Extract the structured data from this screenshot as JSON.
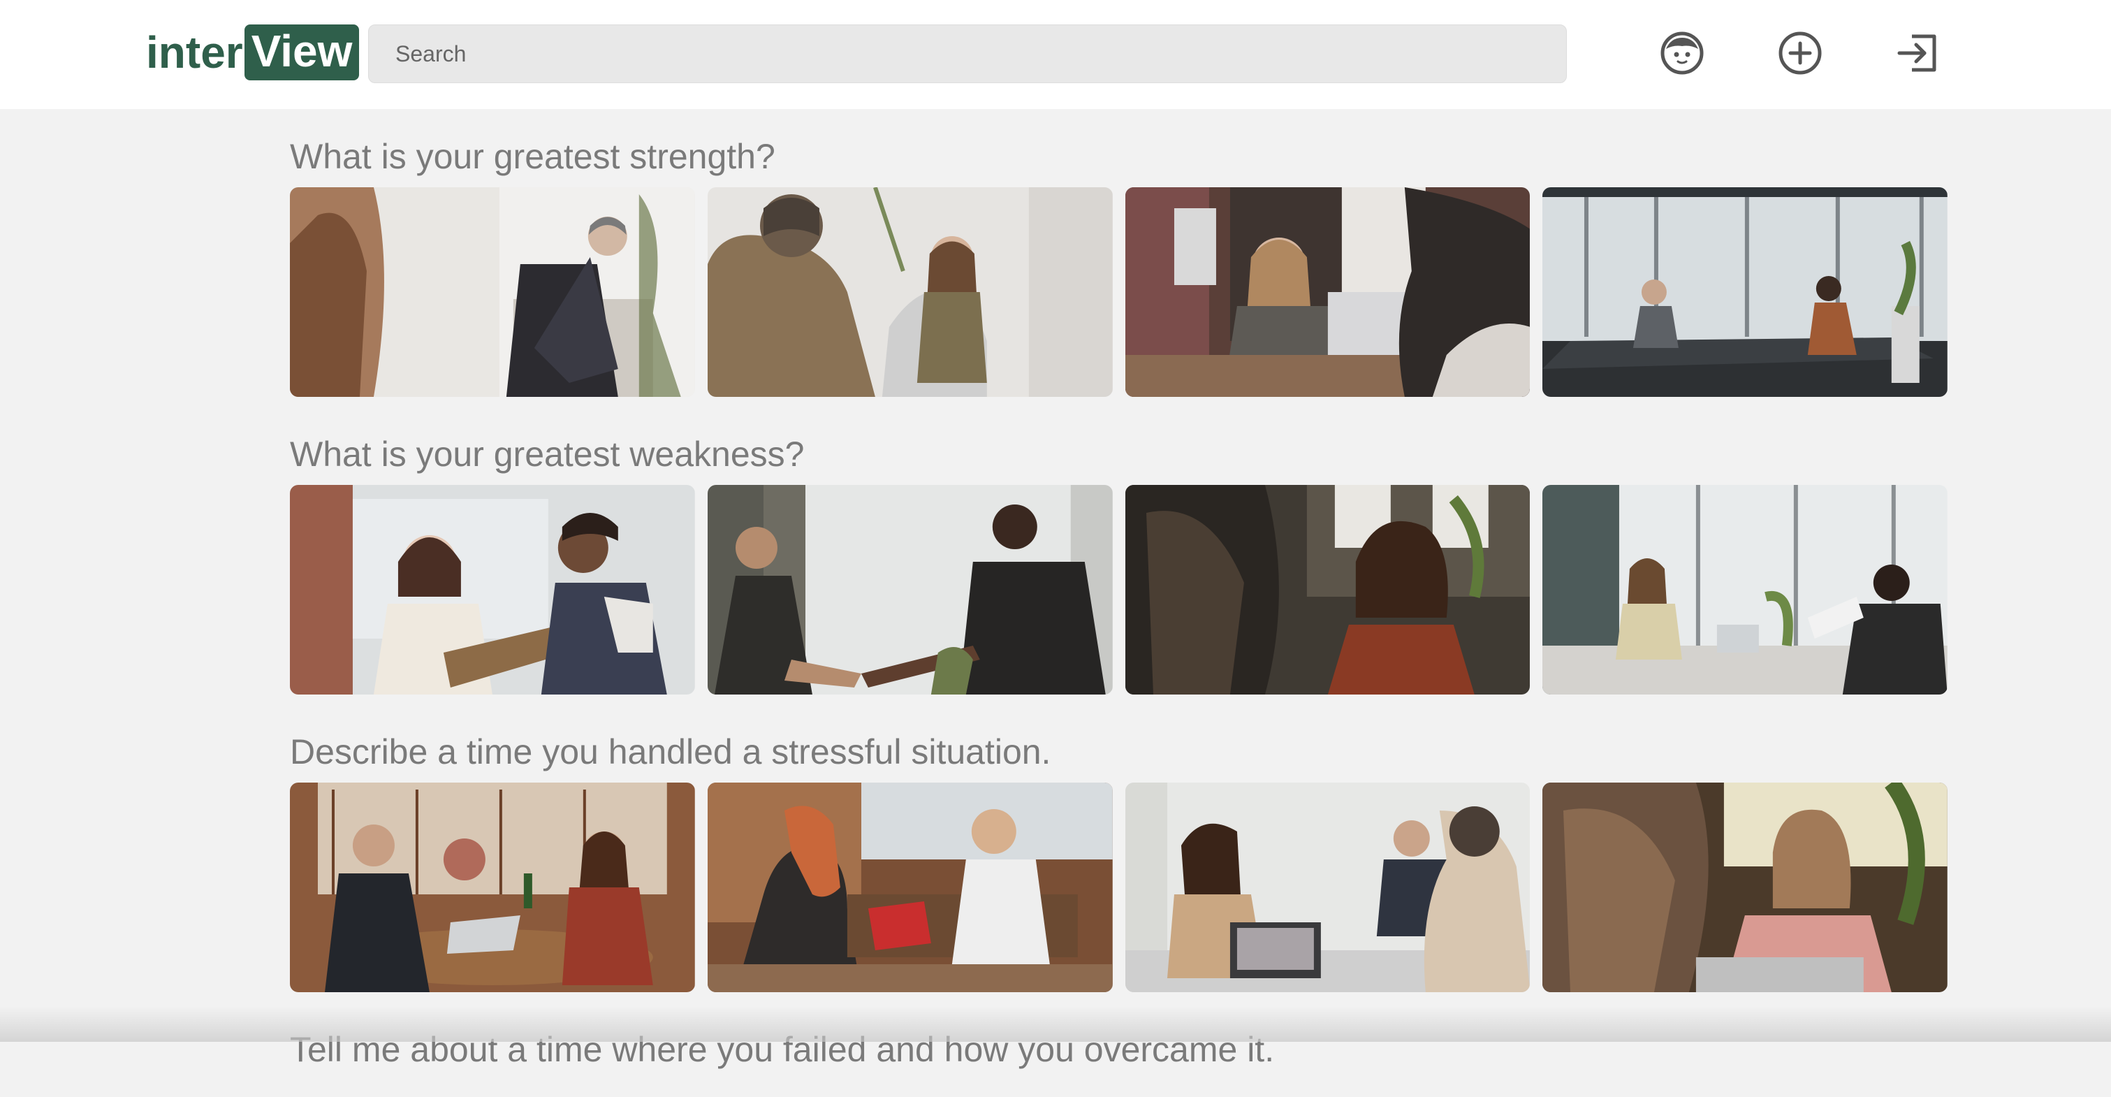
{
  "logo": {
    "part1": "inter",
    "part2": "View"
  },
  "search": {
    "placeholder": "Search"
  },
  "nav": [
    {
      "name": "profile-face-icon",
      "label": "Profile"
    },
    {
      "name": "add-circle-icon",
      "label": "Add"
    },
    {
      "name": "sign-out-icon",
      "label": "Sign out"
    }
  ],
  "sections": [
    {
      "title": "What is your greatest strength?"
    },
    {
      "title": "What is your greatest weakness?"
    },
    {
      "title": "Describe a time you handled a stressful situation."
    },
    {
      "title": "Tell me about a time where you failed and how you overcame it."
    }
  ],
  "colors": {
    "brand": "#2f5f4b",
    "header_bg": "#ffffff",
    "page_bg": "#f2f2f2",
    "title_text": "#7a7a7a"
  }
}
